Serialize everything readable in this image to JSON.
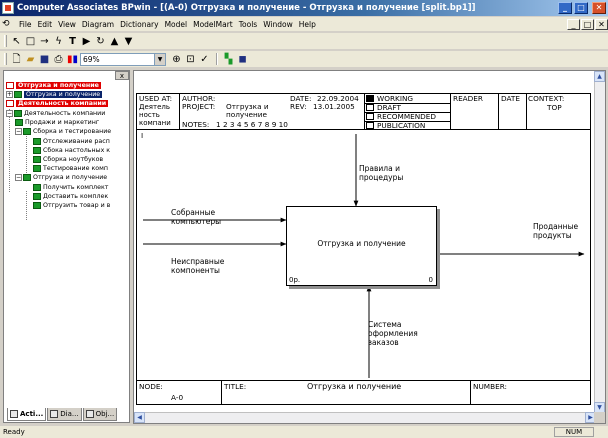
{
  "window": {
    "title": "Computer Associates BPwin - [(A-0) Отгрузка и получение - Отгрузка и получение  [split.bp1]]",
    "minimize": "_",
    "maximize": "□",
    "close": "✕"
  },
  "menu": {
    "items": [
      "File",
      "Edit",
      "View",
      "Diagram",
      "Dictionary",
      "Model",
      "ModelMart",
      "Tools",
      "Window",
      "Help"
    ],
    "doc_min": "_",
    "doc_max": "□",
    "doc_close": "✕"
  },
  "toolbar": {
    "zoom_value": "69%"
  },
  "tree": {
    "items": [
      {
        "label": "Отгрузка и получение",
        "style": "red"
      },
      {
        "label": "Отгрузка и получение",
        "style": "blue"
      },
      {
        "label": "Деятельность компании",
        "style": "red"
      },
      {
        "label": "Деятельность компании",
        "style": "plain"
      },
      {
        "label": "Продажи и маркетинг",
        "style": "plain"
      },
      {
        "label": "Сборка и тестирование",
        "style": "plain"
      },
      {
        "label": "Отслеживание расп",
        "style": "plain"
      },
      {
        "label": "Сбока настольных к",
        "style": "plain"
      },
      {
        "label": "Сборка ноутбуков",
        "style": "plain"
      },
      {
        "label": "Тестирование комп",
        "style": "plain"
      },
      {
        "label": "Отгрузка и получение",
        "style": "plain"
      },
      {
        "label": "Получить комплект",
        "style": "plain"
      },
      {
        "label": "Доставить комплек",
        "style": "plain"
      },
      {
        "label": "Отгрузить товар и в",
        "style": "plain"
      }
    ],
    "tabs": [
      "Acti...",
      "Dia...",
      "Obj..."
    ],
    "close_glyph": "x"
  },
  "header": {
    "used_at": "USED AT:",
    "used_at_value": "Деятель ность компани",
    "author_label": "AUTHOR:",
    "project_label": "PROJECT:",
    "project_value": "Отгрузка и получение",
    "notes_label": "NOTES:",
    "notes_value": "1  2  3  4  5  6  7  8  9  10",
    "date_label": "DATE:",
    "date_value": "22.09.2004",
    "rev_label": "REV:",
    "rev_value": "13.01.2005",
    "status": [
      "WORKING",
      "DRAFT",
      "RECOMMENDED",
      "PUBLICATION"
    ],
    "reader": "READER",
    "date2": "DATE",
    "context_label": "CONTEXT:",
    "context_value": "TOP"
  },
  "diagram": {
    "box_label": "Отгрузка и получение",
    "box_cost": "0р.",
    "box_number": "0",
    "inputs": [
      "Собранные компьютеры",
      "Неисправные компоненты"
    ],
    "control": "Правила и процедуры",
    "output": "Проданные продукты",
    "mechanism": "Система оформления заказов",
    "marker": "I"
  },
  "footer": {
    "node_label": "NODE:",
    "node_value": "A-0",
    "title_label": "TITLE:",
    "title_value": "Отгрузка и получение",
    "number_label": "NUMBER:"
  },
  "status": {
    "text": "Ready",
    "num": "NUM"
  }
}
